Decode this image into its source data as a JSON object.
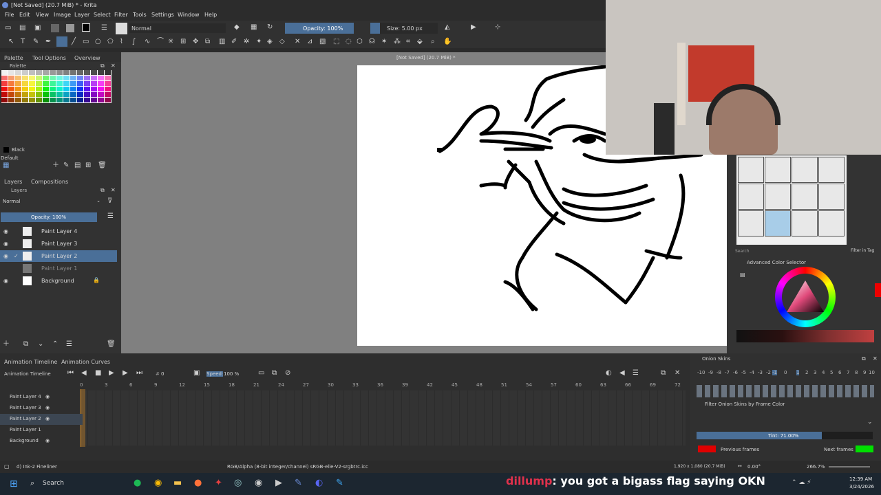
{
  "window": {
    "title": "[Not Saved]  (20.7 MiB) * - Krita"
  },
  "menu": [
    "File",
    "Edit",
    "View",
    "Image",
    "Layer",
    "Select",
    "Filter",
    "Tools",
    "Settings",
    "Window",
    "Help"
  ],
  "toolbar": {
    "blend_mode": "Normal",
    "opacity": "Opacity: 100%",
    "size": "Size: 5.00 px"
  },
  "docked_tabs": [
    "Palette",
    "Tool Options",
    "Overview"
  ],
  "doc_title": "[Not Saved]  (20.7 MiB) *",
  "palette": {
    "header": "Palette",
    "color_name": "Black",
    "set_name": "Default"
  },
  "layers_panel": {
    "tabs": [
      "Layers",
      "Compositions"
    ],
    "header": "Layers",
    "blend": "Normal",
    "opacity": "Opacity:  100%",
    "layers": [
      "Paint Layer 4",
      "Paint Layer 3",
      "Paint Layer 2",
      "Paint Layer 1",
      "Background"
    ]
  },
  "brushes": {
    "search_placeholder": "Search",
    "filter_label": "Filter in Tag"
  },
  "color_selector": {
    "title": "Advanced Color Selector"
  },
  "timeline": {
    "tabs": [
      "Animation Timeline",
      "Animation Curves"
    ],
    "title": "Animation Timeline",
    "frame": "0",
    "speed_label": "Speed:",
    "speed_value": "100 %",
    "frame_numbers": [
      "0",
      "3",
      "6",
      "9",
      "12",
      "15",
      "18",
      "21",
      "24",
      "27",
      "30",
      "33",
      "36",
      "39",
      "42",
      "45",
      "48",
      "51",
      "54",
      "57",
      "60",
      "63",
      "66",
      "69",
      "72"
    ],
    "rows": [
      "Paint Layer 4",
      "Paint Layer 3",
      "Paint Layer 2",
      "Paint Layer 1",
      "Background"
    ]
  },
  "onion": {
    "title": "Onion Skins",
    "numbers": [
      "-10",
      "-9",
      "-8",
      "-7",
      "-6",
      "-5",
      "-4",
      "-3",
      "-2",
      "-1",
      "0",
      "1",
      "2",
      "3",
      "4",
      "5",
      "6",
      "7",
      "8",
      "9",
      "10"
    ],
    "filter_label": "Filter Onion Skins by Frame Color",
    "tint": "Tint: 71.00%",
    "tint_value": 0.71,
    "previous_label": "Previous frames",
    "next_label": "Next frames",
    "prev_color": "#e00000",
    "next_color": "#00e000"
  },
  "status": {
    "brush": "d) Ink-2 Fineliner",
    "color_info": "RGB/Alpha (8-bit integer/channel)  sRGB-elle-V2-srgbtrc.icc",
    "dims": "1,920 x 1,080 (20.7 MiB)",
    "rotation": "0.00°",
    "zoom": "266.7%"
  },
  "chat_overlay": {
    "user": "dillump",
    "message": ": you got a bigass flag saying OKN"
  },
  "taskbar": {
    "search": "Search",
    "time": "12:39 AM",
    "date": "3/24/2026"
  }
}
